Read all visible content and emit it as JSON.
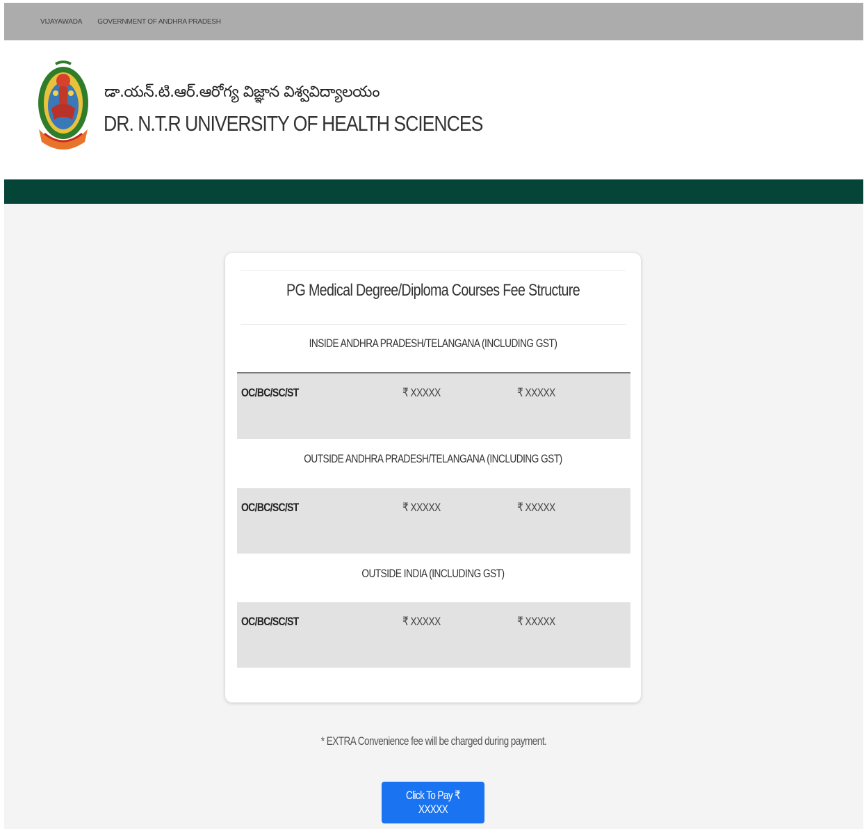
{
  "topbar": {
    "city": "VIJAYAWADA",
    "government": "GOVERNMENT OF ANDHRA PRADESH"
  },
  "header": {
    "name_telugu": "డా.యన్.టి.ఆర్.ఆరోగ్య విజ్ఞాన విశ్వవిద్యాలయం",
    "name_english": "DR. N.T.R UNIVERSITY OF HEALTH SCIENCES",
    "logo_icon": "university-emblem-icon"
  },
  "fee_card": {
    "title": "PG Medical Degree/Diploma Courses Fee Structure",
    "sections": [
      {
        "title": "INSIDE ANDHRA PRADESH/TELANGANA (INCLUDING GST)",
        "rows": [
          {
            "category": "OC/BC/SC/ST",
            "amount_1": "₹ XXXXX",
            "amount_2": "₹ XXXXX"
          }
        ]
      },
      {
        "title": "OUTSIDE ANDHRA PRADESH/TELANGANA (INCLUDING GST)",
        "rows": [
          {
            "category": "OC/BC/SC/ST",
            "amount_1": "₹ XXXXX",
            "amount_2": "₹ XXXXX"
          }
        ]
      },
      {
        "title": "OUTSIDE INDIA (INCLUDING GST)",
        "rows": [
          {
            "category": "OC/BC/SC/ST",
            "amount_1": "₹ XXXXX",
            "amount_2": "₹ XXXXX"
          }
        ]
      }
    ]
  },
  "note": "* EXTRA Convenience fee will be charged during payment.",
  "pay_button": {
    "label": "Click To Pay ₹ XXXXX"
  },
  "colors": {
    "topbar": "#acacac",
    "greenbar": "#044538",
    "page_background": "#f4f4f4",
    "row_background": "#e2e2e2",
    "button": "#1a73f0"
  }
}
